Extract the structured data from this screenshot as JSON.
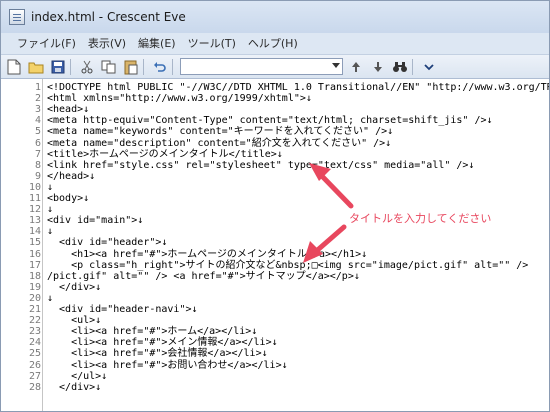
{
  "window": {
    "title": "index.html - Crescent Eve"
  },
  "menu": [
    "ファイル(F)",
    "表示(V)",
    "編集(E)",
    "ツール(T)",
    "ヘルプ(H)"
  ],
  "toolbar": {
    "buttons": [
      "new-file-icon",
      "open-folder-icon",
      "save-icon",
      "cut-icon",
      "copy-icon",
      "paste-icon",
      "undo-icon"
    ],
    "search_value": ""
  },
  "editor": {
    "line_numbers": [
      "1",
      "2",
      "3",
      "4",
      "5",
      "6",
      "7",
      "8",
      "9",
      "10",
      "11",
      "12",
      "13",
      "14",
      "15",
      "16",
      "17",
      "18",
      "19",
      "20",
      "21",
      "22",
      "23",
      "24",
      "25",
      "26",
      "27",
      "28"
    ],
    "lines": [
      "<!DOCTYPE html PUBLIC \"-//W3C//DTD XHTML 1.0 Transitional//EN\" \"http://www.w3.org/TR",
      "<html xmlns=\"http://www.w3.org/1999/xhtml\">↓",
      "<head>↓",
      "<meta http-equiv=\"Content-Type\" content=\"text/html; charset=shift_jis\" />↓",
      "<meta name=\"keywords\" content=\"キーワードを入れてください\" />↓",
      "<meta name=\"description\" content=\"紹介文を入れてください\" />↓",
      "<title>ホームページのメインタイトル</title>↓",
      "<link href=\"style.css\" rel=\"stylesheet\" type=\"text/css\" media=\"all\" />↓",
      "</head>↓",
      "↓",
      "<body>↓",
      "↓",
      "<div id=\"main\">↓",
      "↓",
      "  <div id=\"header\">↓",
      "    <h1><a href=\"#\">ホームページのメインタイトル</a></h1>↓",
      "    <p class=\"h_right\">サイトの紹介文など&nbsp;□<img src=\"image/pict.gif\" alt=\"\" />",
      "/pict.gif\" alt=\"\" /> <a href=\"#\">サイトマップ</a></p>↓",
      "  </div>↓",
      "↓",
      "  <div id=\"header-navi\">↓",
      "    <ul>↓",
      "    <li><a href=\"#\">ホーム</a></li>↓",
      "    <li><a href=\"#\">メイン情報</a></li>↓",
      "    <li><a href=\"#\">会社情報</a></li>↓",
      "    <li><a href=\"#\">お問い合わせ</a></li>↓",
      "    </ul>↓",
      "  </div>↓"
    ]
  },
  "annotation": {
    "text": "タイトルを入力してください",
    "color": "#e8475e"
  }
}
